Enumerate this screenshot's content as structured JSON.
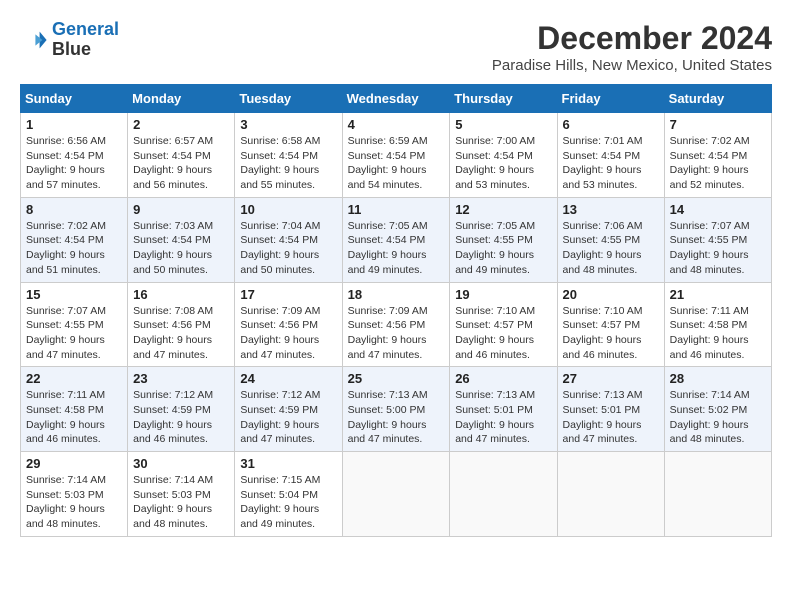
{
  "header": {
    "logo_line1": "General",
    "logo_line2": "Blue",
    "month": "December 2024",
    "location": "Paradise Hills, New Mexico, United States"
  },
  "days_of_week": [
    "Sunday",
    "Monday",
    "Tuesday",
    "Wednesday",
    "Thursday",
    "Friday",
    "Saturday"
  ],
  "weeks": [
    [
      {
        "day": "1",
        "sunrise": "6:56 AM",
        "sunset": "4:54 PM",
        "daylight": "9 hours and 57 minutes."
      },
      {
        "day": "2",
        "sunrise": "6:57 AM",
        "sunset": "4:54 PM",
        "daylight": "9 hours and 56 minutes."
      },
      {
        "day": "3",
        "sunrise": "6:58 AM",
        "sunset": "4:54 PM",
        "daylight": "9 hours and 55 minutes."
      },
      {
        "day": "4",
        "sunrise": "6:59 AM",
        "sunset": "4:54 PM",
        "daylight": "9 hours and 54 minutes."
      },
      {
        "day": "5",
        "sunrise": "7:00 AM",
        "sunset": "4:54 PM",
        "daylight": "9 hours and 53 minutes."
      },
      {
        "day": "6",
        "sunrise": "7:01 AM",
        "sunset": "4:54 PM",
        "daylight": "9 hours and 53 minutes."
      },
      {
        "day": "7",
        "sunrise": "7:02 AM",
        "sunset": "4:54 PM",
        "daylight": "9 hours and 52 minutes."
      }
    ],
    [
      {
        "day": "8",
        "sunrise": "7:02 AM",
        "sunset": "4:54 PM",
        "daylight": "9 hours and 51 minutes."
      },
      {
        "day": "9",
        "sunrise": "7:03 AM",
        "sunset": "4:54 PM",
        "daylight": "9 hours and 50 minutes."
      },
      {
        "day": "10",
        "sunrise": "7:04 AM",
        "sunset": "4:54 PM",
        "daylight": "9 hours and 50 minutes."
      },
      {
        "day": "11",
        "sunrise": "7:05 AM",
        "sunset": "4:54 PM",
        "daylight": "9 hours and 49 minutes."
      },
      {
        "day": "12",
        "sunrise": "7:05 AM",
        "sunset": "4:55 PM",
        "daylight": "9 hours and 49 minutes."
      },
      {
        "day": "13",
        "sunrise": "7:06 AM",
        "sunset": "4:55 PM",
        "daylight": "9 hours and 48 minutes."
      },
      {
        "day": "14",
        "sunrise": "7:07 AM",
        "sunset": "4:55 PM",
        "daylight": "9 hours and 48 minutes."
      }
    ],
    [
      {
        "day": "15",
        "sunrise": "7:07 AM",
        "sunset": "4:55 PM",
        "daylight": "9 hours and 47 minutes."
      },
      {
        "day": "16",
        "sunrise": "7:08 AM",
        "sunset": "4:56 PM",
        "daylight": "9 hours and 47 minutes."
      },
      {
        "day": "17",
        "sunrise": "7:09 AM",
        "sunset": "4:56 PM",
        "daylight": "9 hours and 47 minutes."
      },
      {
        "day": "18",
        "sunrise": "7:09 AM",
        "sunset": "4:56 PM",
        "daylight": "9 hours and 47 minutes."
      },
      {
        "day": "19",
        "sunrise": "7:10 AM",
        "sunset": "4:57 PM",
        "daylight": "9 hours and 46 minutes."
      },
      {
        "day": "20",
        "sunrise": "7:10 AM",
        "sunset": "4:57 PM",
        "daylight": "9 hours and 46 minutes."
      },
      {
        "day": "21",
        "sunrise": "7:11 AM",
        "sunset": "4:58 PM",
        "daylight": "9 hours and 46 minutes."
      }
    ],
    [
      {
        "day": "22",
        "sunrise": "7:11 AM",
        "sunset": "4:58 PM",
        "daylight": "9 hours and 46 minutes."
      },
      {
        "day": "23",
        "sunrise": "7:12 AM",
        "sunset": "4:59 PM",
        "daylight": "9 hours and 46 minutes."
      },
      {
        "day": "24",
        "sunrise": "7:12 AM",
        "sunset": "4:59 PM",
        "daylight": "9 hours and 47 minutes."
      },
      {
        "day": "25",
        "sunrise": "7:13 AM",
        "sunset": "5:00 PM",
        "daylight": "9 hours and 47 minutes."
      },
      {
        "day": "26",
        "sunrise": "7:13 AM",
        "sunset": "5:01 PM",
        "daylight": "9 hours and 47 minutes."
      },
      {
        "day": "27",
        "sunrise": "7:13 AM",
        "sunset": "5:01 PM",
        "daylight": "9 hours and 47 minutes."
      },
      {
        "day": "28",
        "sunrise": "7:14 AM",
        "sunset": "5:02 PM",
        "daylight": "9 hours and 48 minutes."
      }
    ],
    [
      {
        "day": "29",
        "sunrise": "7:14 AM",
        "sunset": "5:03 PM",
        "daylight": "9 hours and 48 minutes."
      },
      {
        "day": "30",
        "sunrise": "7:14 AM",
        "sunset": "5:03 PM",
        "daylight": "9 hours and 48 minutes."
      },
      {
        "day": "31",
        "sunrise": "7:15 AM",
        "sunset": "5:04 PM",
        "daylight": "9 hours and 49 minutes."
      },
      null,
      null,
      null,
      null
    ]
  ],
  "labels": {
    "sunrise_prefix": "Sunrise: ",
    "sunset_prefix": "Sunset: ",
    "daylight_prefix": "Daylight: "
  }
}
